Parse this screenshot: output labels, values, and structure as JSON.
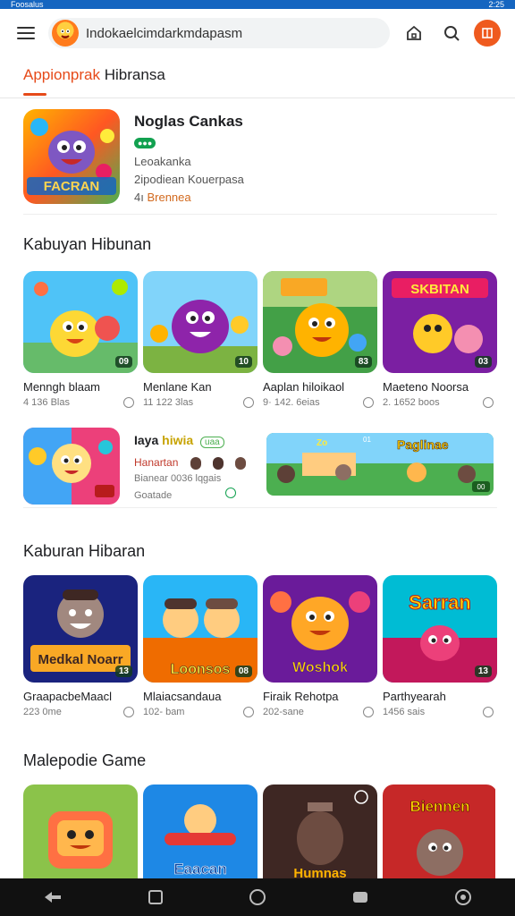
{
  "status": {
    "left": "Foosalus",
    "right": "2:25"
  },
  "search": {
    "value": "Indokaelcimdarkmdapasm"
  },
  "tab": {
    "label_a": "Appionprak",
    "label_b": " Hibransa"
  },
  "featured": {
    "title": "Noglas Cankas",
    "badge": "●●●",
    "line1": "Leoakanka",
    "line2": "2ipodiean Kouerpasa",
    "line3_prefix": "4ı ",
    "line3_value": "Brennea"
  },
  "section1": {
    "title": "Kabuyan Hibunan",
    "cards": [
      {
        "title": "Menngh blaam",
        "meta": "4 136 Blas",
        "tag": "09"
      },
      {
        "title": "Menlane Kan",
        "meta": "11 122 3las",
        "tag": "10"
      },
      {
        "title": "Aaplan hiloikaol",
        "meta": "9· 142. 6eias",
        "tag": "83"
      },
      {
        "title": "Maeteno Noorsa",
        "meta": "2. 1652 boos",
        "tag": "03"
      }
    ]
  },
  "promo": {
    "title_a": "Iaya ",
    "title_b": "hiwia",
    "chip": "uaa",
    "sub": "Hanartan",
    "line1": "Bianear 0036 lqgais",
    "line2": "Goatade",
    "banner_left": "Zo",
    "banner_mid": "01",
    "banner_right": "Paglinae",
    "banner_tag": "00"
  },
  "section2": {
    "title": "Kaburan Hibaran",
    "cards": [
      {
        "title": "GraapacbeMaacl",
        "meta": "223 0me",
        "tag": "13",
        "art": "Medkal Noarr"
      },
      {
        "title": "Mlaiacsandaua",
        "meta": "102- bam",
        "tag": "08",
        "art": "Loonsos"
      },
      {
        "title": "Firaik Rehotpa",
        "meta": "202-sane",
        "tag": "",
        "art": "Woshok"
      },
      {
        "title": "Parthyearah",
        "meta": "1456 sais",
        "tag": "13",
        "art": "Sarran"
      }
    ]
  },
  "section3": {
    "title": "Malepodie Game",
    "cards": [
      {
        "art": ""
      },
      {
        "art": "Eaacan"
      },
      {
        "art": "Humnas"
      },
      {
        "art": "Biennen"
      }
    ]
  },
  "colors": {
    "accent": "#e64a19",
    "status_bar": "#1565c0",
    "badge_green": "#12a150"
  }
}
